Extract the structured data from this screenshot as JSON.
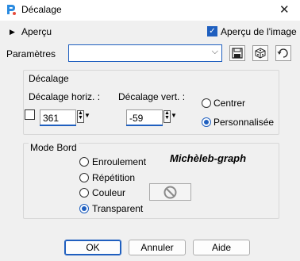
{
  "window": {
    "title": "Décalage",
    "close_icon": "close-icon"
  },
  "preview": {
    "toggle_label": "Aperçu",
    "image_preview_label": "Aperçu de l'image",
    "image_preview_checked": true
  },
  "params": {
    "label": "Paramètres",
    "value": ""
  },
  "offset": {
    "group_label": "Décalage",
    "horiz_label": "Décalage horiz. :",
    "horiz_value": "361",
    "vert_label": "Décalage vert. :",
    "vert_value": "-59",
    "center_label": "Centrer",
    "custom_label": "Personnalisée",
    "selected": "Personnalisée"
  },
  "edge": {
    "group_label": "Mode Bord",
    "options": [
      "Enroulement",
      "Répétition",
      "Couleur",
      "Transparent"
    ],
    "selected": "Transparent"
  },
  "watermark": "Michèleb-graph",
  "buttons": {
    "ok": "OK",
    "cancel": "Annuler",
    "help": "Aide"
  },
  "colors": {
    "accent": "#1f5fbf"
  }
}
